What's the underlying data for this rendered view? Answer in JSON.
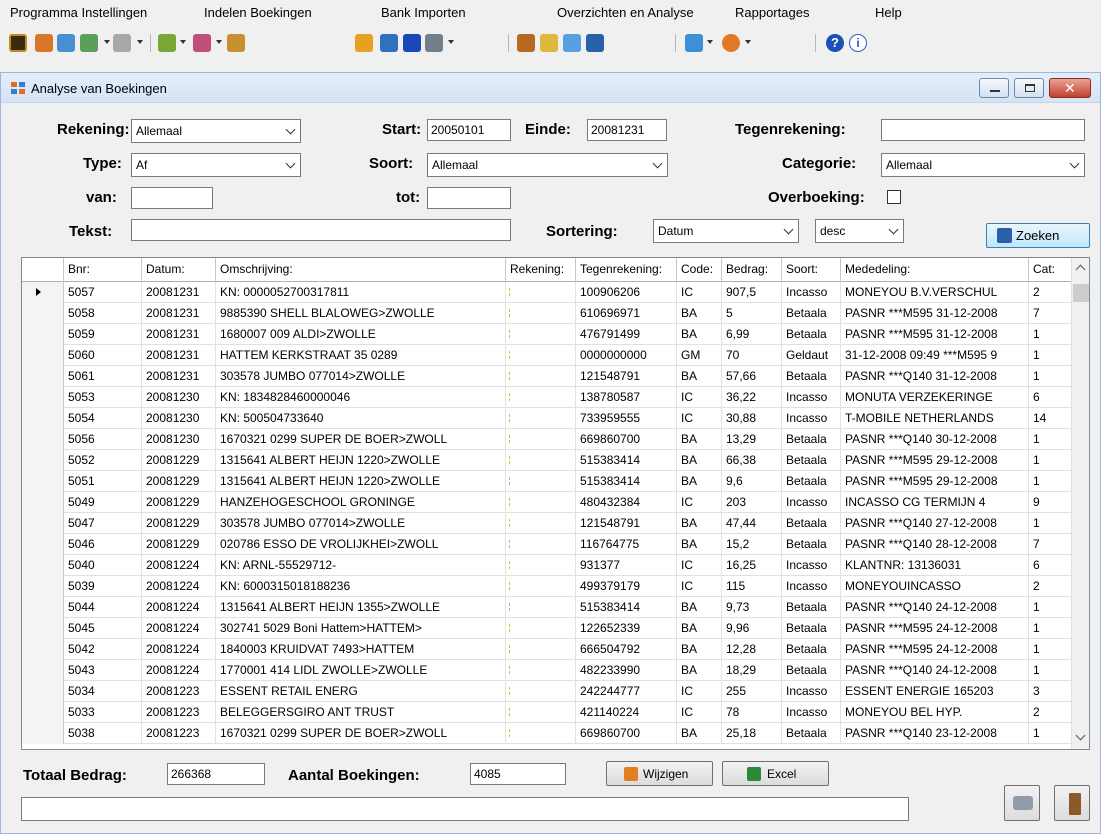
{
  "menu": [
    "Programma Instellingen",
    "Indelen Boekingen",
    "Bank Importen",
    "Overzichten en Analyse",
    "Rapportages",
    "Help"
  ],
  "window": {
    "title": "Analyse van Boekingen"
  },
  "filters": {
    "rekening_label": "Rekening:",
    "rekening_value": "Allemaal",
    "start_label": "Start:",
    "start_value": "20050101",
    "einde_label": "Einde:",
    "einde_value": "20081231",
    "tegenrekening_label": "Tegenrekening:",
    "tegenrekening_value": "",
    "type_label": "Type:",
    "type_value": "Af",
    "soort_label": "Soort:",
    "soort_value": "Allemaal",
    "categorie_label": "Categorie:",
    "categorie_value": "Allemaal",
    "van_label": "van:",
    "van_value": "",
    "tot_label": "tot:",
    "tot_value": "",
    "overboeking_label": "Overboeking:",
    "overboeking_checked": false,
    "tekst_label": "Tekst:",
    "tekst_value": "",
    "sortering_label": "Sortering:",
    "sortering_value": "Datum",
    "sortering_dir": "desc",
    "zoeken_label": "Zoeken"
  },
  "grid": {
    "columns": [
      "Bnr:",
      "Datum:",
      "Omschrijving:",
      "Rekening:",
      "Tegenrekening:",
      "Code:",
      "Bedrag:",
      "Soort:",
      "Mededeling:",
      "Cat:"
    ],
    "rows": [
      [
        "5057",
        "20081231",
        "KN: 0000052700317811",
        "",
        "100906206",
        "IC",
        "907,5",
        "Incasso",
        "MONEYOU B.V.VERSCHUL",
        "2"
      ],
      [
        "5058",
        "20081231",
        "9885390 SHELL BLALOWEG>ZWOLLE",
        "",
        "610696971",
        "BA",
        "5",
        "Betaala",
        "PASNR ***M595 31-12-2008",
        "7"
      ],
      [
        "5059",
        "20081231",
        "1680007 009 ALDI>ZWOLLE",
        "",
        "476791499",
        "BA",
        "6,99",
        "Betaala",
        "PASNR ***M595 31-12-2008",
        "1"
      ],
      [
        "5060",
        "20081231",
        "HATTEM KERKSTRAAT 35      0289",
        "",
        "0000000000",
        "GM",
        "70",
        "Geldaut",
        "31-12-2008 09:49 ***M595 9",
        "1"
      ],
      [
        "5061",
        "20081231",
        "303578  JUMBO 077014>ZWOLLE",
        "",
        "121548791",
        "BA",
        "57,66",
        "Betaala",
        "PASNR ***Q140 31-12-2008",
        "1"
      ],
      [
        "5053",
        "20081230",
        "KN: 1834828460000046",
        "",
        "138780587",
        "IC",
        "36,22",
        "Incasso",
        "MONUTA VERZEKERINGE",
        "6"
      ],
      [
        "5054",
        "20081230",
        "KN: 500504733640",
        "",
        "733959555",
        "IC",
        "30,88",
        "Incasso",
        "T-MOBILE NETHERLANDS",
        "14"
      ],
      [
        "5056",
        "20081230",
        "1670321 0299 SUPER DE BOER>ZWOLL",
        "",
        "669860700",
        "BA",
        "13,29",
        "Betaala",
        "PASNR ***Q140 30-12-2008",
        "1"
      ],
      [
        "5052",
        "20081229",
        "1315641 ALBERT HEIJN 1220>ZWOLLE",
        "",
        "515383414",
        "BA",
        "66,38",
        "Betaala",
        "PASNR ***M595 29-12-2008",
        "1"
      ],
      [
        "5051",
        "20081229",
        "1315641 ALBERT HEIJN 1220>ZWOLLE",
        "",
        "515383414",
        "BA",
        "9,6",
        "Betaala",
        "PASNR ***M595 29-12-2008",
        "1"
      ],
      [
        "5049",
        "20081229",
        "HANZEHOGESCHOOL GRONINGE",
        "",
        "480432384",
        "IC",
        "203",
        "Incasso",
        "INCASSO CG TERMIJN 4",
        "9"
      ],
      [
        "5047",
        "20081229",
        "303578  JUMBO 077014>ZWOLLE",
        "",
        "121548791",
        "BA",
        "47,44",
        "Betaala",
        "PASNR ***Q140 27-12-2008",
        "1"
      ],
      [
        "5046",
        "20081229",
        "020786  ESSO DE VROLIJKHEI>ZWOLL",
        "",
        "116764775",
        "BA",
        "15,2",
        "Betaala",
        "PASNR ***Q140 28-12-2008",
        "7"
      ],
      [
        "5040",
        "20081224",
        "KN: ARNL-55529712-",
        "",
        "931377",
        "IC",
        "16,25",
        "Incasso",
        "KLANTNR: 13136031",
        "6"
      ],
      [
        "5039",
        "20081224",
        "KN: 6000315018188236",
        "",
        "499379179",
        "IC",
        "115",
        "Incasso",
        "MONEYOUINCASSO",
        "2"
      ],
      [
        "5044",
        "20081224",
        "1315641 ALBERT HEIJN 1355>ZWOLLE",
        "",
        "515383414",
        "BA",
        "9,73",
        "Betaala",
        "PASNR ***Q140 24-12-2008",
        "1"
      ],
      [
        "5045",
        "20081224",
        "302741  5029 Boni Hattem>HATTEM>",
        "",
        "122652339",
        "BA",
        "9,96",
        "Betaala",
        "PASNR ***M595 24-12-2008",
        "1"
      ],
      [
        "5042",
        "20081224",
        "1840003 KRUIDVAT 7493>HATTEM",
        "",
        "666504792",
        "BA",
        "12,28",
        "Betaala",
        "PASNR ***M595 24-12-2008",
        "1"
      ],
      [
        "5043",
        "20081224",
        "1770001 414 LIDL ZWOLLE>ZWOLLE",
        "",
        "482233990",
        "BA",
        "18,29",
        "Betaala",
        "PASNR ***Q140 24-12-2008",
        "1"
      ],
      [
        "5034",
        "20081223",
        "ESSENT RETAIL ENERG",
        "",
        "242244777",
        "IC",
        "255",
        "Incasso",
        "ESSENT ENERGIE 165203",
        "3"
      ],
      [
        "5033",
        "20081223",
        "BELEGGERSGIRO ANT TRUST",
        "",
        "421140224",
        "IC",
        "78",
        "Incasso",
        "MONEYOU BEL HYP.",
        "2"
      ],
      [
        "5038",
        "20081223",
        "1670321 0299 SUPER DE BOER>ZWOLL",
        "",
        "669860700",
        "BA",
        "25,18",
        "Betaala",
        "PASNR ***Q140 23-12-2008",
        "1"
      ]
    ]
  },
  "totals": {
    "totaal_label": "Totaal Bedrag:",
    "totaal_value": "266368",
    "aantal_label": "Aantal Boekingen:",
    "aantal_value": "4085",
    "wijzigen_label": "Wijzigen",
    "excel_label": "Excel",
    "status_text": ""
  },
  "colors": {
    "window_bg": "#eef3fa",
    "accent": "#3c7fb1",
    "close": "#c4402c"
  }
}
